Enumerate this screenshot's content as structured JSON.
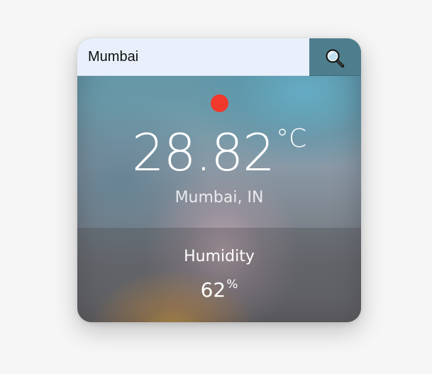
{
  "search": {
    "value": "Mumbai",
    "button_icon": "search-icon"
  },
  "status": {
    "color": "#f0392b"
  },
  "weather": {
    "temperature": "28.82",
    "temperature_unit": "°C",
    "location": "Mumbai, IN"
  },
  "stats": {
    "humidity_label": "Humidity",
    "humidity_value": "62",
    "humidity_unit": "%"
  }
}
